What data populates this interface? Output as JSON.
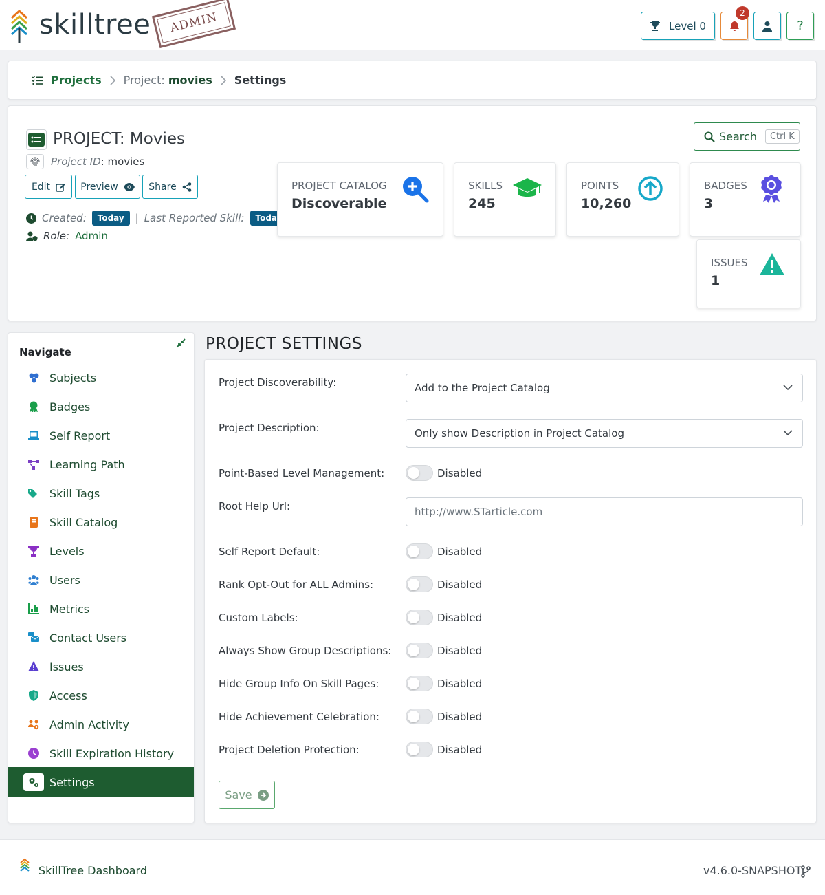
{
  "header": {
    "logo_text": "skilltree",
    "stamp_text": "ADMIN",
    "level_label": "Level 0",
    "notification_count": "2",
    "help_label": "?"
  },
  "breadcrumb": {
    "projects": "Projects",
    "project_prefix": "Project:",
    "project_id": "movies",
    "current": "Settings"
  },
  "project": {
    "title": "PROJECT: Movies",
    "id_label": "Project ID",
    "id_value": ": movies",
    "buttons": {
      "edit": "Edit",
      "preview": "Preview",
      "share": "Share"
    },
    "created_label": "Created:",
    "created_value": "Today",
    "last_reported_label": "Last Reported Skill:",
    "last_reported_value": "Today",
    "separator": "|",
    "role_label": "Role:",
    "role_value": "Admin",
    "search_label": "Search",
    "search_shortcut": "Ctrl K"
  },
  "stats": {
    "catalog": {
      "label": "PROJECT CATALOG",
      "value": "Discoverable"
    },
    "skills": {
      "label": "SKILLS",
      "value": "245"
    },
    "points": {
      "label": "POINTS",
      "value": "10,260"
    },
    "badges": {
      "label": "BADGES",
      "value": "3"
    },
    "issues": {
      "label": "ISSUES",
      "value": "1"
    }
  },
  "nav": {
    "title": "Navigate",
    "items": [
      {
        "label": "Subjects",
        "icon": "cubes-icon",
        "color": "#2f6fd0"
      },
      {
        "label": "Badges",
        "icon": "award-icon",
        "color": "#1a9e4a"
      },
      {
        "label": "Self Report",
        "icon": "laptop-icon",
        "color": "#1a8fc9"
      },
      {
        "label": "Learning Path",
        "icon": "project-diagram-icon",
        "color": "#7b3fc4"
      },
      {
        "label": "Skill Tags",
        "icon": "tags-icon",
        "color": "#18a98a"
      },
      {
        "label": "Skill Catalog",
        "icon": "book-icon",
        "color": "#e8751a"
      },
      {
        "label": "Levels",
        "icon": "trophy-icon",
        "color": "#8a2fc4"
      },
      {
        "label": "Users",
        "icon": "users-icon",
        "color": "#2f7fd0"
      },
      {
        "label": "Metrics",
        "icon": "chart-icon",
        "color": "#1a9e4a"
      },
      {
        "label": "Contact Users",
        "icon": "mail-bulk-icon",
        "color": "#1a8fc9"
      },
      {
        "label": "Issues",
        "icon": "warning-icon",
        "color": "#5a3fd0"
      },
      {
        "label": "Access",
        "icon": "shield-icon",
        "color": "#18a98a"
      },
      {
        "label": "Admin Activity",
        "icon": "users-cog-icon",
        "color": "#e8751a"
      },
      {
        "label": "Skill Expiration History",
        "icon": "clock-icon",
        "color": "#9a3fd0"
      },
      {
        "label": "Settings",
        "icon": "cogs-icon",
        "color": "#1e5c30"
      }
    ]
  },
  "settings": {
    "title": "PROJECT SETTINGS",
    "discoverability": {
      "label": "Project Discoverability:",
      "value": "Add to the Project Catalog"
    },
    "description": {
      "label": "Project Description:",
      "value": "Only show Description in Project Catalog"
    },
    "point_based": {
      "label": "Point-Based Level Management:",
      "state": "Disabled"
    },
    "root_help_url": {
      "label": "Root Help Url:",
      "placeholder": "http://www.STarticle.com"
    },
    "self_report_default": {
      "label": "Self Report Default:",
      "state": "Disabled"
    },
    "rank_opt_out": {
      "label": "Rank Opt-Out for ALL Admins:",
      "state": "Disabled"
    },
    "custom_labels": {
      "label": "Custom Labels:",
      "state": "Disabled"
    },
    "always_show_group": {
      "label": "Always Show Group Descriptions:",
      "state": "Disabled"
    },
    "hide_group_info": {
      "label": "Hide Group Info On Skill Pages:",
      "state": "Disabled"
    },
    "hide_celebration": {
      "label": "Hide Achievement Celebration:",
      "state": "Disabled"
    },
    "deletion_protection": {
      "label": "Project Deletion Protection:",
      "state": "Disabled"
    },
    "save_label": "Save"
  },
  "footer": {
    "name": "SkillTree Dashboard",
    "version": "v4.6.0-SNAPSHOT"
  }
}
